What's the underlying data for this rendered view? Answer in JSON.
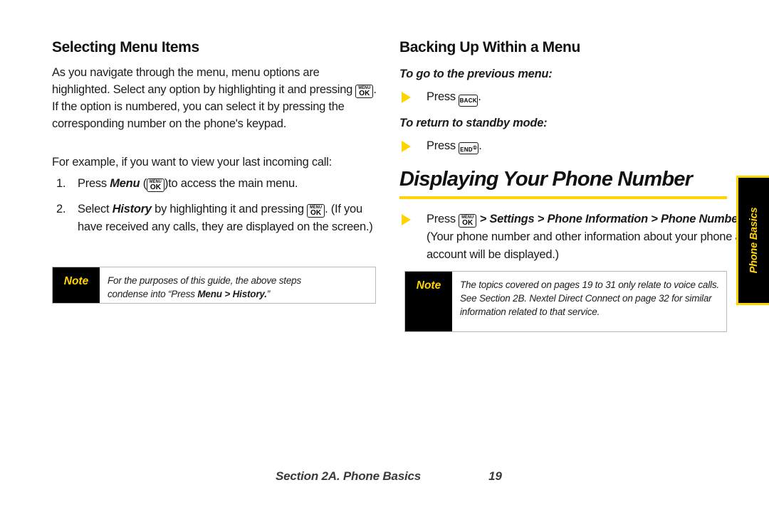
{
  "page": {
    "accent_yellow": "#FFD400",
    "background": "#ffffff"
  },
  "left_column": {
    "heading": "Selecting Menu Items",
    "intro_1": "As you navigate through the menu, menu options are highlighted. Select any option by highlighting it and pressing",
    "intro_2": ". If the option is numbered, you can select it by pressing the corresponding number on the phone's keypad.",
    "example_lead": "For example, if you want to view your last incoming call:",
    "steps": [
      {
        "num": "1.",
        "text_a": "Press ",
        "emphasis": "Menu",
        "text_b": " (",
        "key": "menu-ok",
        "text_c": ")to access the main menu."
      },
      {
        "num": "2.",
        "text_a": "Select ",
        "emphasis": "History",
        "text_b": " by highlighting it and pressing ",
        "key": "menu-ok",
        "text_c": ". (If you have received any calls, they are displayed on the screen.)"
      }
    ],
    "note": {
      "label": "Note",
      "line_1": "For the purposes of this guide, the above steps",
      "line_2_a": "condense into “Press ",
      "line_2_bold": "Menu > History.",
      "line_2_b": "”"
    }
  },
  "right_column": {
    "heading": "Backing Up Within a Menu",
    "subhead_1": "To go to the previous menu:",
    "bullet_1": {
      "text_a": "Press ",
      "key": "back",
      "text_b": "."
    },
    "subhead_2": "To return to standby mode:",
    "bullet_2": {
      "text_a": "Press ",
      "key": "end-power",
      "text_b": "."
    },
    "section_title": "Displaying Your Phone Number",
    "bullet_3": {
      "text_a": "Press ",
      "key": "menu-ok",
      "path": " > Settings > Phone Information > Phone Number",
      "text_b": ". (Your phone number and other information about your phone and account will be displayed.)"
    },
    "note": {
      "label": "Note",
      "text": "The topics covered on pages 19 to 31 only relate to voice calls. See Section 2B. Nextel Direct Connect on page 32 for similar information related to that service."
    }
  },
  "side_tab": {
    "label": "Phone Basics"
  },
  "footer": {
    "section": "Section 2A. Phone Basics",
    "page_number": "19"
  },
  "keys": {
    "menu_ok": {
      "top": "MENU",
      "bottom": "OK"
    },
    "back": {
      "label": "BACK"
    },
    "end": {
      "label": "END",
      "sup": "①"
    }
  }
}
